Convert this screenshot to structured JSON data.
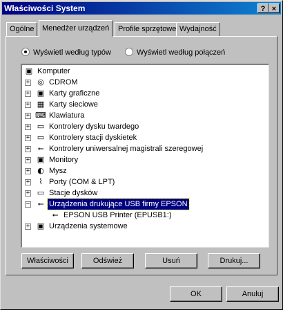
{
  "window": {
    "title": "Właściwości System"
  },
  "titlebar_buttons": {
    "help": "?",
    "close": "×"
  },
  "tabs": [
    "Ogólne",
    "Menedżer urządzeń",
    "Profile sprzętowe",
    "Wydajność"
  ],
  "view_options": {
    "by_type": "Wyświetl według typów",
    "by_connection": "Wyświetl według połączeń",
    "selected": "by_type"
  },
  "tree": {
    "root": "Komputer",
    "items": [
      {
        "label": "CDROM",
        "icon": "cdrom-icon",
        "glyph": "◎"
      },
      {
        "label": "Karty graficzne",
        "icon": "display-adapter-icon",
        "glyph": "▣"
      },
      {
        "label": "Karty sieciowe",
        "icon": "network-adapter-icon",
        "glyph": "▦"
      },
      {
        "label": "Klawiatura",
        "icon": "keyboard-icon",
        "glyph": "⌨"
      },
      {
        "label": "Kontrolery dysku twardego",
        "icon": "disk-controller-icon",
        "glyph": "▭"
      },
      {
        "label": "Kontrolery stacji dyskietek",
        "icon": "floppy-controller-icon",
        "glyph": "▭"
      },
      {
        "label": "Kontrolery uniwersalnej magistrali szeregowej",
        "icon": "usb-icon",
        "glyph": "⭠"
      },
      {
        "label": "Monitory",
        "icon": "monitor-icon",
        "glyph": "▣"
      },
      {
        "label": "Mysz",
        "icon": "mouse-icon",
        "glyph": "◐"
      },
      {
        "label": "Porty (COM & LPT)",
        "icon": "port-icon",
        "glyph": "⌇"
      },
      {
        "label": "Stacje dysków",
        "icon": "drive-icon",
        "glyph": "▭"
      },
      {
        "label": "Urządzenia drukujące USB firmy EPSON",
        "icon": "usb-icon",
        "glyph": "⭠"
      },
      {
        "label": "EPSON USB Printer (EPUSB1:)",
        "icon": "usb-icon",
        "glyph": "⭠"
      },
      {
        "label": "Urządzenia systemowe",
        "icon": "system-devices-icon",
        "glyph": "▣"
      }
    ],
    "selected_label": "Urządzenia drukujące USB firmy EPSON"
  },
  "buttons": {
    "properties": "Właściwości",
    "refresh": "Odśwież",
    "remove": "Usuń",
    "print": "Drukuj...",
    "ok": "OK",
    "cancel": "Anuluj"
  },
  "colors": {
    "title_bar": "#000080",
    "selection": "#000080",
    "face": "#c0c0c0"
  }
}
